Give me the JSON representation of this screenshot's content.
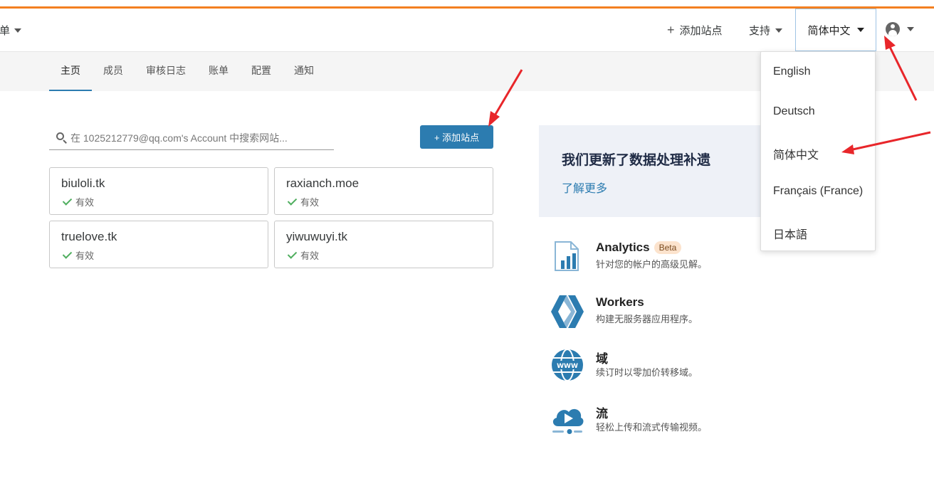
{
  "colors": {
    "accent": "#f38020",
    "primary": "#2c7cb0",
    "success": "#4fae5f",
    "annotation": "#e8262a"
  },
  "header": {
    "menu_label": "菜单",
    "add_site_label": "添加站点",
    "support_label": "支持",
    "language_label": "简体中文",
    "user_icon": "user-circle-icon"
  },
  "tabs": [
    {
      "label": "主页",
      "active": true
    },
    {
      "label": "成员"
    },
    {
      "label": "审核日志"
    },
    {
      "label": "账单"
    },
    {
      "label": "配置"
    },
    {
      "label": "通知"
    }
  ],
  "search": {
    "placeholder": "在 1025212779@qq.com's Account 中搜索网站..."
  },
  "add_site_button": "+ 添加站点",
  "sites": [
    {
      "name": "biuloli.tk",
      "status": "有效"
    },
    {
      "name": "raxianch.moe",
      "status": "有效"
    },
    {
      "name": "truelove.tk",
      "status": "有效"
    },
    {
      "name": "yiwuwuyi.tk",
      "status": "有效"
    }
  ],
  "promo": {
    "title": "我们更新了数据处理补遗",
    "link": "了解更多"
  },
  "products": [
    {
      "title": "Analytics",
      "badge": "Beta",
      "desc": "针对您的帐户的高级见解。",
      "icon": "analytics-icon"
    },
    {
      "title": "Workers",
      "desc": "构建无服务器应用程序。",
      "icon": "workers-icon"
    },
    {
      "title": "域",
      "desc": "续订时以零加价转移域。",
      "icon": "globe-www-icon"
    },
    {
      "title": "流",
      "desc": "轻松上传和流式传输视频。",
      "icon": "stream-cloud-icon"
    }
  ],
  "language_menu": [
    "English",
    "Deutsch",
    "简体中文",
    "Français (France)",
    "日本語"
  ]
}
